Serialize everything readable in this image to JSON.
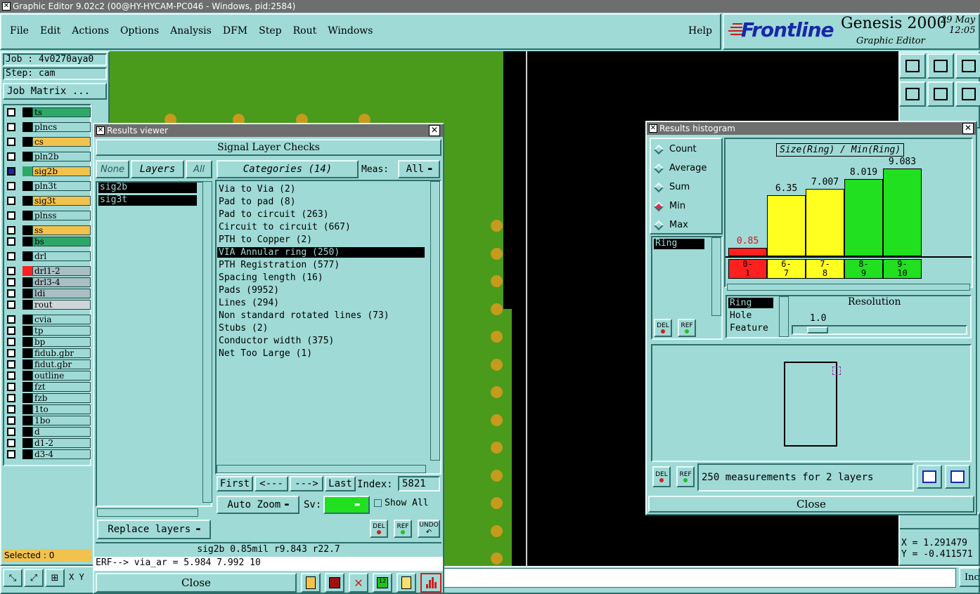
{
  "window_title": "Graphic Editor 9.02c2 (00@HY-HYCAM-PC046 - Windows, pid:2584)",
  "menu": [
    "File",
    "Edit",
    "Actions",
    "Options",
    "Analysis",
    "DFM",
    "Step",
    "Rout",
    "Windows"
  ],
  "help": "Help",
  "brand": {
    "logo": "Frontline",
    "product": "Genesis 2000",
    "subtitle": "Graphic Editor",
    "date": "29 May",
    "time": "12:05"
  },
  "job": "Job : 4v0270aya0",
  "step": "Step: cam",
  "job_matrix": "Job Matrix ...",
  "layers": [
    {
      "name": "ts",
      "color": "#2ea868"
    },
    {
      "name": "plncs",
      "color": "#9fdad6"
    },
    {
      "name": "cs",
      "color": "#f2c24e"
    },
    {
      "name": "pln2b",
      "color": "#9fdad6"
    },
    {
      "name": "sig2b",
      "color": "#f2c24e"
    },
    {
      "name": "pln3t",
      "color": "#9fdad6"
    },
    {
      "name": "sig3t",
      "color": "#f2c24e"
    },
    {
      "name": "plnss",
      "color": "#9fdad6"
    },
    {
      "name": "ss",
      "color": "#f2c24e"
    },
    {
      "name": "bs",
      "color": "#2ea868"
    },
    {
      "name": "drl",
      "color": "#9fdad6"
    },
    {
      "name": "drl1-2",
      "color": "#a8bfc4"
    },
    {
      "name": "drl3-4",
      "color": "#a8bfc4"
    },
    {
      "name": "ldi",
      "color": "#a8bfc4"
    },
    {
      "name": "rout",
      "color": "#cfd6d8"
    },
    {
      "name": "cvia",
      "color": "#9fdad6"
    },
    {
      "name": "tp",
      "color": "#9fdad6"
    },
    {
      "name": "bp",
      "color": "#9fdad6"
    },
    {
      "name": "fidub.gbr",
      "color": "#9fdad6"
    },
    {
      "name": "fidut.gbr",
      "color": "#9fdad6"
    },
    {
      "name": "outline",
      "color": "#9fdad6"
    },
    {
      "name": "fzt",
      "color": "#9fdad6"
    },
    {
      "name": "fzb",
      "color": "#9fdad6"
    },
    {
      "name": "1to",
      "color": "#9fdad6"
    },
    {
      "name": "1bo",
      "color": "#9fdad6"
    },
    {
      "name": "d",
      "color": "#9fdad6"
    },
    {
      "name": "d1-2",
      "color": "#9fdad6"
    },
    {
      "name": "d3-4",
      "color": "#9fdad6"
    }
  ],
  "selected": "Selected : 0",
  "xy_label": "X Y",
  "results_viewer": {
    "title": "Results viewer",
    "header": "Signal Layer Checks",
    "none": "None",
    "layers_label": "Layers",
    "all": "All",
    "categories_label": "Categories (14)",
    "meas_label": "Meas:",
    "meas_value": "All",
    "layer_list": [
      "sig2b",
      "sig3t"
    ],
    "categories": [
      "Via to Via (2)",
      "Pad to pad (8)",
      "Pad to circuit (263)",
      "Circuit to circuit (667)",
      "PTH to Copper (2)",
      "VIA Annular ring (250)",
      "PTH Registration (577)",
      "Spacing length (16)",
      "Pads (9952)",
      "Lines (294)",
      "Non standard rotated lines (73)",
      "Stubs (2)",
      "Conductor width (375)",
      "Net Too Large (1)"
    ],
    "first": "First",
    "prev": "<---",
    "next": "--->",
    "last": "Last",
    "index_label": "Index:",
    "index_value": "5821",
    "auto_zoom": "Auto Zoom",
    "sv_label": "Sv:",
    "show_all": "Show All",
    "del": "DEL",
    "ref": "REF",
    "undo": "UNDO",
    "replace_layers": "Replace layers",
    "info_line": "sig2b 0.85mil  r9.843  r22.7",
    "erf_line": "ERF--> via_ar = 5.984 7.992 10",
    "close": "Close"
  },
  "histogram": {
    "title": "Results histogram",
    "modes": [
      "Count",
      "Average",
      "Sum",
      "Min",
      "Max"
    ],
    "selected_mode": "Min",
    "list_item": "Ring",
    "chart_title": "Size(Ring) / Min(Ring)",
    "bars": [
      {
        "label": "0.85",
        "bin": "0-\n1",
        "value": 0.85,
        "color": "#ff2020"
      },
      {
        "label": "6.35",
        "bin": "6-\n7",
        "value": 6.35,
        "color": "#ffff20"
      },
      {
        "label": "7.007",
        "bin": "7-\n8",
        "value": 7.007,
        "color": "#ffff20"
      },
      {
        "label": "8.019",
        "bin": "8-\n9",
        "value": 8.019,
        "color": "#20e020"
      },
      {
        "label": "9.083",
        "bin": "9-\n10",
        "value": 9.083,
        "color": "#20e020"
      }
    ],
    "attr_list": [
      "Ring",
      "Hole",
      "Feature"
    ],
    "resolution_label": "Resolution",
    "resolution_value": "1.0",
    "del": "DEL",
    "ref": "REF",
    "measurements": "250 measurements for 2 layers",
    "close": "Close"
  },
  "coords": {
    "x": "X = 1.291479",
    "y": "Y = -0.411571"
  },
  "bottom_right": "Inc"
}
